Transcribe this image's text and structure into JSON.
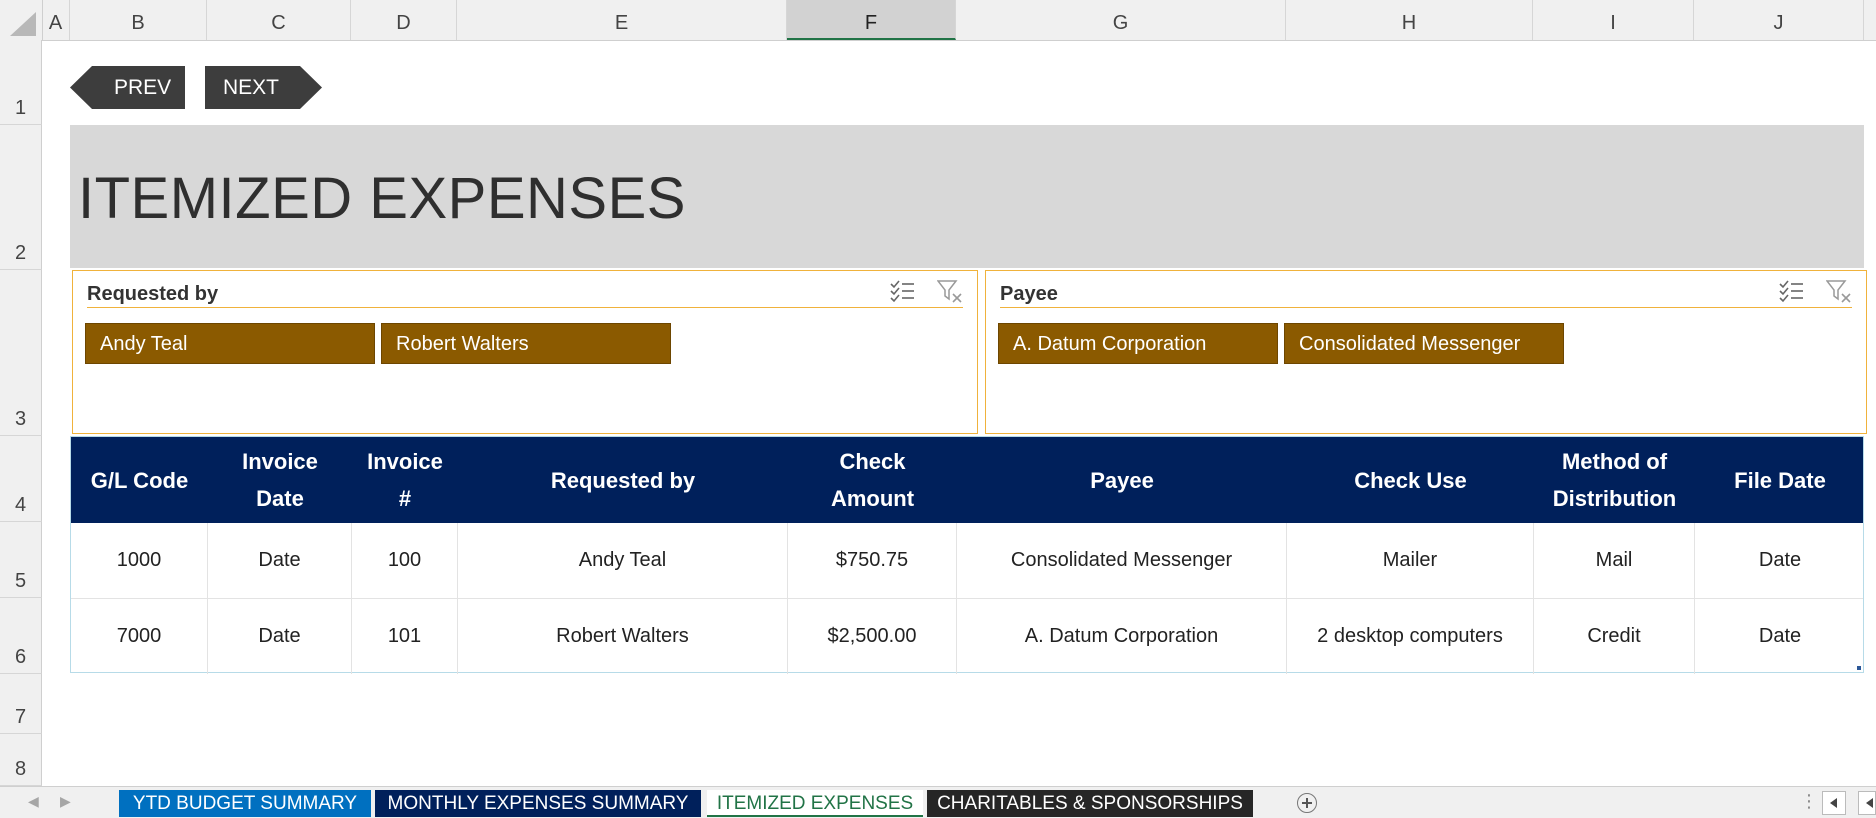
{
  "columns": [
    "A",
    "B",
    "C",
    "D",
    "E",
    "F",
    "G",
    "H",
    "I",
    "J"
  ],
  "selected_column": "F",
  "rows": [
    "1",
    "2",
    "3",
    "4",
    "5",
    "6",
    "7",
    "8"
  ],
  "nav": {
    "prev": "PREV",
    "next": "NEXT"
  },
  "title": "ITEMIZED EXPENSES",
  "slicers": {
    "requested_by": {
      "label": "Requested by",
      "items": [
        "Andy Teal",
        "Robert Walters"
      ]
    },
    "payee": {
      "label": "Payee",
      "items": [
        "A. Datum Corporation",
        "Consolidated Messenger"
      ]
    }
  },
  "table": {
    "headers": [
      [
        "G/L Code"
      ],
      [
        "Invoice",
        "Date"
      ],
      [
        "Invoice",
        "#"
      ],
      [
        "Requested by"
      ],
      [
        "Check",
        "Amount"
      ],
      [
        "Payee"
      ],
      [
        "Check Use"
      ],
      [
        "Method of",
        "Distribution"
      ],
      [
        "File Date"
      ]
    ],
    "rows": [
      [
        "1000",
        "Date",
        "100",
        "Andy Teal",
        "$750.75",
        "Consolidated Messenger",
        "Mailer",
        "Mail",
        "Date"
      ],
      [
        "7000",
        "Date",
        "101",
        "Robert Walters",
        "$2,500.00",
        "A. Datum Corporation",
        "2 desktop computers",
        "Credit",
        "Date"
      ]
    ]
  },
  "sheet_tabs": [
    {
      "label": "YTD BUDGET SUMMARY",
      "style": "ytd"
    },
    {
      "label": "MONTHLY EXPENSES SUMMARY",
      "style": "monthly"
    },
    {
      "label": "ITEMIZED EXPENSES",
      "style": "active"
    },
    {
      "label": "CHARITABLES & SPONSORSHIPS",
      "style": "charit"
    }
  ],
  "colors": {
    "table_header": "#00205b",
    "slicer_chip": "#8b5a00",
    "slicer_border": "#f0b23b",
    "title_band": "#d8d8d8",
    "nav_button": "#3d3d3d"
  },
  "icons": [
    "select-all-corner-icon",
    "multi-select-icon",
    "clear-filter-icon",
    "add-sheet-icon",
    "scroll-left-icon"
  ]
}
